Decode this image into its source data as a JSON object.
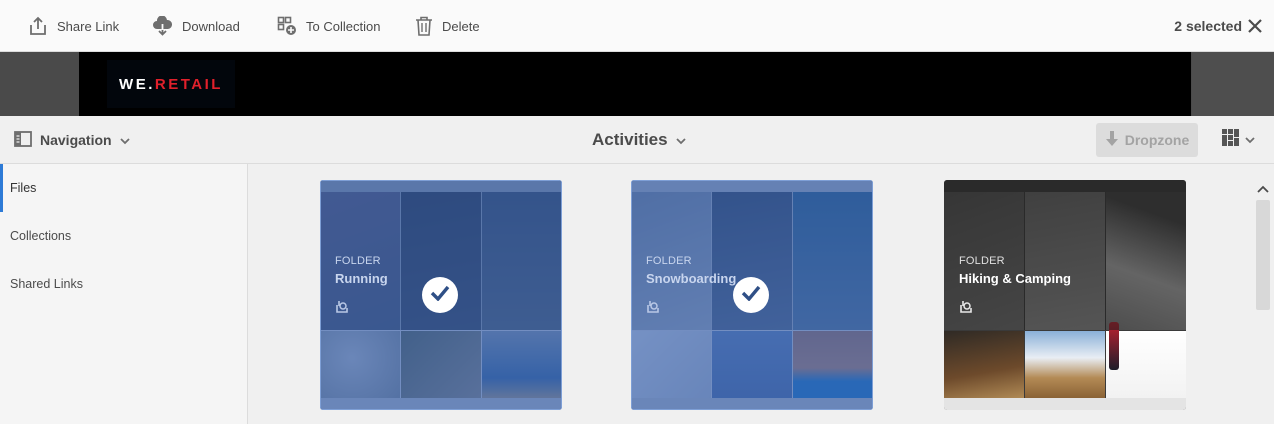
{
  "actions": {
    "share_link": "Share Link",
    "download": "Download",
    "to_collection": "To Collection",
    "delete": "Delete",
    "selected_count": "2 selected"
  },
  "banner": {
    "logo_part1": "WE.",
    "logo_part2": "RETAIL"
  },
  "navbar": {
    "navigation_label": "Navigation",
    "title": "Activities",
    "dropzone_label": "Dropzone"
  },
  "sidebar": {
    "items": [
      {
        "label": "Files",
        "active": true
      },
      {
        "label": "Collections",
        "active": false
      },
      {
        "label": "Shared Links",
        "active": false
      }
    ]
  },
  "cards": [
    {
      "kind": "FOLDER",
      "name": "Running",
      "selected": true
    },
    {
      "kind": "FOLDER",
      "name": "Snowboarding",
      "selected": true
    },
    {
      "kind": "FOLDER",
      "name": "Hiking & Camping",
      "selected": false
    }
  ],
  "colors": {
    "accent": "#2d7ad6",
    "selection": "#305aa8",
    "logo_red": "#e0202b"
  },
  "icons": [
    "share-icon",
    "download-icon",
    "to-collection-icon",
    "delete-icon",
    "close-icon",
    "sidebar-toggle-icon",
    "chevron-down-icon",
    "dropzone-download-icon",
    "grid-view-icon",
    "folder-share-icon",
    "checkmark-icon",
    "scroll-up-icon"
  ]
}
